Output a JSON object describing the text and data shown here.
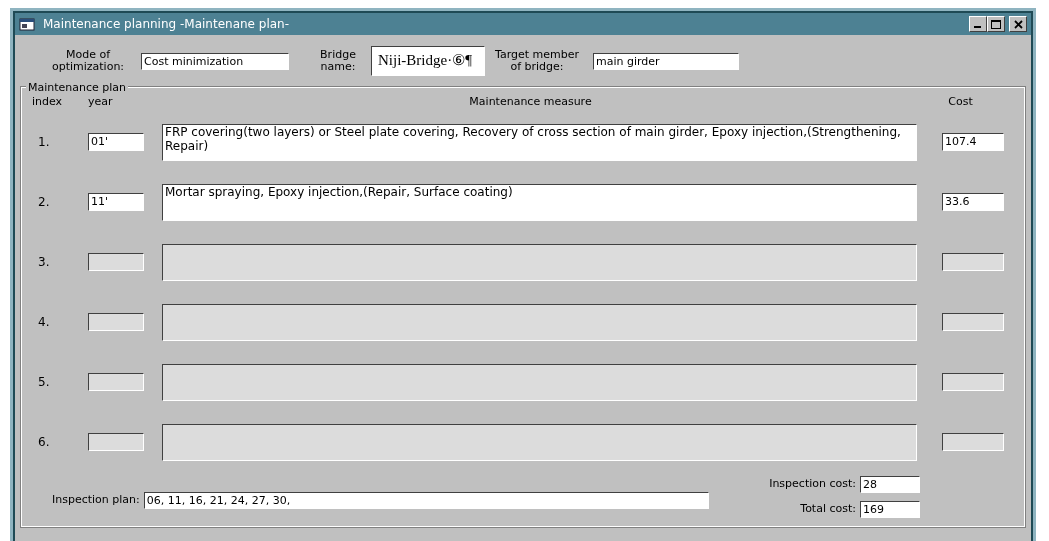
{
  "window": {
    "title": "Maintenance planning -Maintenane plan-"
  },
  "header": {
    "mode_label": "Mode of optimization:",
    "mode_value": "Cost minimization",
    "bridge_label": "Bridge name:",
    "bridge_value": "Niji-Bridge·⑥¶",
    "member_label": "Target member of bridge:",
    "member_value": "main girder"
  },
  "plan": {
    "title": "Maintenance plan",
    "columns": [
      "index",
      "year",
      "Maintenance measure",
      "Cost"
    ],
    "rows": [
      {
        "index": "1.",
        "year": "01'",
        "measure": "FRP covering(two layers) or Steel plate covering, Recovery of cross section of main girder, Epoxy injection,(Strengthening, Repair)",
        "cost": "107.4",
        "disabled": false
      },
      {
        "index": "2.",
        "year": "11'",
        "measure": "Mortar spraying, Epoxy injection,(Repair, Surface coating)",
        "cost": "33.6",
        "disabled": false
      },
      {
        "index": "3.",
        "disabled": true
      },
      {
        "index": "4.",
        "disabled": true
      },
      {
        "index": "5.",
        "disabled": true
      },
      {
        "index": "6.",
        "disabled": true
      }
    ],
    "inspection_plan_label": "Inspection plan:",
    "inspection_plan": "06, 11, 16, 21, 24, 27, 30,",
    "inspection_cost_label": "Inspection cost:",
    "inspection_cost": "28",
    "total_cost_label": "Total cost:",
    "total_cost": "169"
  }
}
